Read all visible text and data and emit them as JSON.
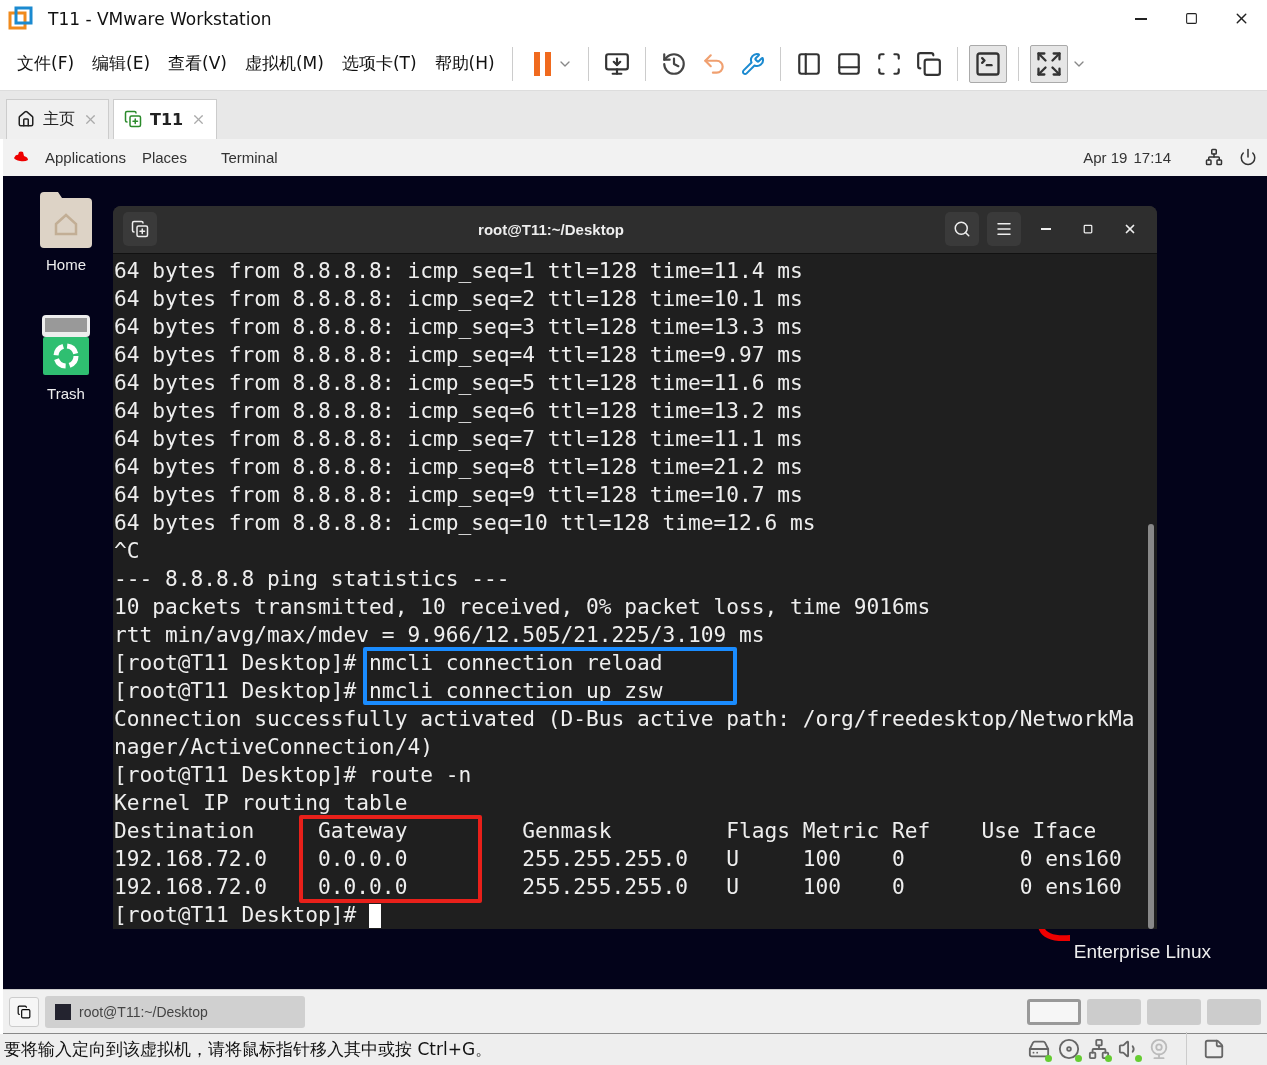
{
  "window": {
    "title": "T11 - VMware Workstation"
  },
  "menu": [
    "文件(F)",
    "编辑(E)",
    "查看(V)",
    "虚拟机(M)",
    "选项卡(T)",
    "帮助(H)"
  ],
  "tabs": [
    {
      "label": "主页",
      "selected": false
    },
    {
      "label": "T11",
      "selected": true
    }
  ],
  "guest": {
    "top_bar": {
      "items": [
        "Applications",
        "Places",
        "Terminal"
      ],
      "date": "Apr 19",
      "time": "17:14"
    },
    "desktop_icons": [
      {
        "label": "Home",
        "kind": "folder"
      },
      {
        "label": "Trash",
        "kind": "trash"
      }
    ],
    "branding": [
      "Enterprise Linux"
    ],
    "terminal": {
      "title": "root@T11:~/Desktop",
      "prompt": "[root@T11 Desktop]# ",
      "lines": [
        "64 bytes from 8.8.8.8: icmp_seq=1 ttl=128 time=11.4 ms",
        "64 bytes from 8.8.8.8: icmp_seq=2 ttl=128 time=10.1 ms",
        "64 bytes from 8.8.8.8: icmp_seq=3 ttl=128 time=13.3 ms",
        "64 bytes from 8.8.8.8: icmp_seq=4 ttl=128 time=9.97 ms",
        "64 bytes from 8.8.8.8: icmp_seq=5 ttl=128 time=11.6 ms",
        "64 bytes from 8.8.8.8: icmp_seq=6 ttl=128 time=13.2 ms",
        "64 bytes from 8.8.8.8: icmp_seq=7 ttl=128 time=11.1 ms",
        "64 bytes from 8.8.8.8: icmp_seq=8 ttl=128 time=21.2 ms",
        "64 bytes from 8.8.8.8: icmp_seq=9 ttl=128 time=10.7 ms",
        "64 bytes from 8.8.8.8: icmp_seq=10 ttl=128 time=12.6 ms",
        "^C",
        "--- 8.8.8.8 ping statistics ---",
        "10 packets transmitted, 10 received, 0% packet loss, time 9016ms",
        "rtt min/avg/max/mdev = 9.966/12.505/21.225/3.109 ms",
        "[root@T11 Desktop]# nmcli connection reload",
        "[root@T11 Desktop]# nmcli connection up zsw",
        "Connection successfully activated (D-Bus active path: /org/freedesktop/NetworkMa",
        "nager/ActiveConnection/4)",
        "[root@T11 Desktop]# route -n",
        "Kernel IP routing table",
        "Destination     Gateway         Genmask         Flags Metric Ref    Use Iface",
        "192.168.72.0    0.0.0.0         255.255.255.0   U     100    0         0 ens160",
        "192.168.72.0    0.0.0.0         255.255.255.0   U     100    0         0 ens160"
      ],
      "cursor": true
    },
    "taskbar": {
      "task": "root@T11:~/Desktop",
      "workspaces": [
        {
          "selected": true
        },
        {
          "selected": false
        },
        {
          "selected": false
        },
        {
          "selected": false
        }
      ]
    }
  },
  "annotations": [
    {
      "color": "#1a8cff"
    },
    {
      "color": "#e8201a"
    }
  ],
  "status_bar": {
    "message": "要将输入定向到该虚拟机，请将鼠标指针移入其中或按 Ctrl+G。"
  }
}
